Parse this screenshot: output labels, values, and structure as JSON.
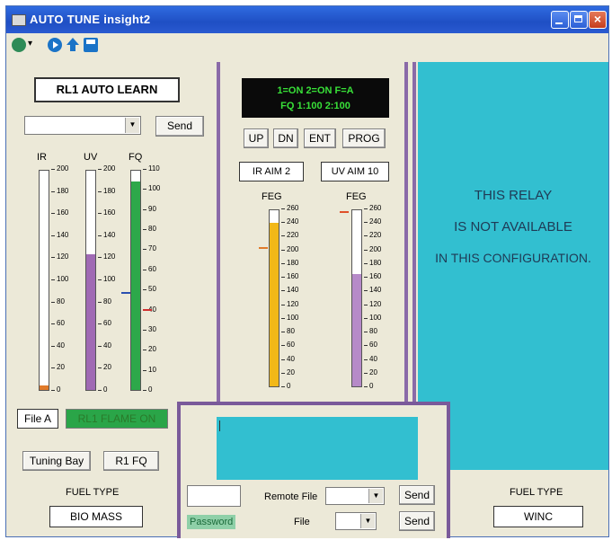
{
  "window": {
    "title": "AUTO TUNE insight2"
  },
  "left": {
    "heading": "RL1 AUTO LEARN",
    "select_value": "",
    "send_label": "Send",
    "meters": [
      {
        "name": "IR",
        "max": 200,
        "level": 0.02,
        "color": "#e07a2a",
        "ticks": [
          "200",
          "180",
          "160",
          "140",
          "120",
          "100",
          "80",
          "60",
          "40",
          "20",
          "0"
        ]
      },
      {
        "name": "UV",
        "max": 200,
        "level": 0.62,
        "color": "#a06ab4",
        "ticks": [
          "200",
          "180",
          "160",
          "140",
          "120",
          "100",
          "80",
          "60",
          "40",
          "20",
          "0"
        ]
      },
      {
        "name": "FQ",
        "max": 110,
        "level": 0.95,
        "color": "#2da84a",
        "ticks": [
          "110",
          "100",
          "90",
          "80",
          "70",
          "60",
          "50",
          "40",
          "30",
          "20",
          "10",
          "0"
        ]
      }
    ],
    "file_label": "File A",
    "flame_status": "RL1 FLAME ON",
    "tuning_bay_label": "Tuning Bay",
    "r1_fq_label": "R1 FQ",
    "fuel_type_label": "FUEL TYPE",
    "fuel_type_value": "BIO MASS"
  },
  "center": {
    "display_line1": "1=ON  2=ON  F=A",
    "display_line2": "FQ 1:100  2:100",
    "buttons": [
      "UP",
      "DN",
      "ENT",
      "PROG"
    ],
    "ir_aim": "IR AIM 2",
    "uv_aim": "UV AIM 10",
    "feg_label_1": "FEG",
    "feg_label_2": "FEG",
    "feg_meters": [
      {
        "level": 0.93,
        "color": "#f2b818"
      },
      {
        "level": 0.64,
        "color": "#b68ac8"
      }
    ],
    "feg_ticks": [
      "260",
      "240",
      "220",
      "200",
      "180",
      "160",
      "140",
      "120",
      "100",
      "80",
      "60",
      "40",
      "20",
      "0"
    ]
  },
  "right": {
    "relay_message": [
      "THIS RELAY",
      "IS NOT AVAILABLE",
      "IN THIS CONFIGURATION."
    ],
    "fuel_type_label": "FUEL TYPE",
    "fuel_type_value": "WINC"
  },
  "bottom": {
    "password_value": "",
    "password_label": "Password",
    "remote_file_label": "Remote File",
    "file_label": "File",
    "send_label_1": "Send",
    "send_label_2": "Send"
  }
}
